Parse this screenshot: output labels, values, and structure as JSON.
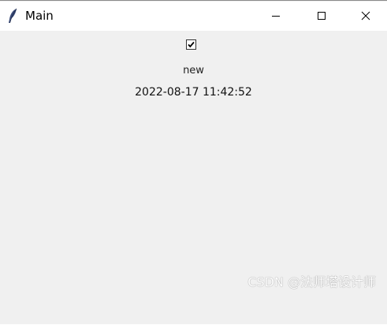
{
  "window": {
    "title": "Main",
    "app_icon": "feather-icon",
    "controls": {
      "minimize_icon": "minimize-icon",
      "maximize_icon": "maximize-icon",
      "close_icon": "close-icon"
    }
  },
  "content": {
    "checkbox": {
      "checked": true
    },
    "label_new": "new",
    "timestamp": "2022-08-17 11:42:52"
  },
  "watermark": "CSDN @法师塔设计师",
  "colors": {
    "titlebar_bg": "#ffffff",
    "content_bg": "#f0f0f0"
  }
}
